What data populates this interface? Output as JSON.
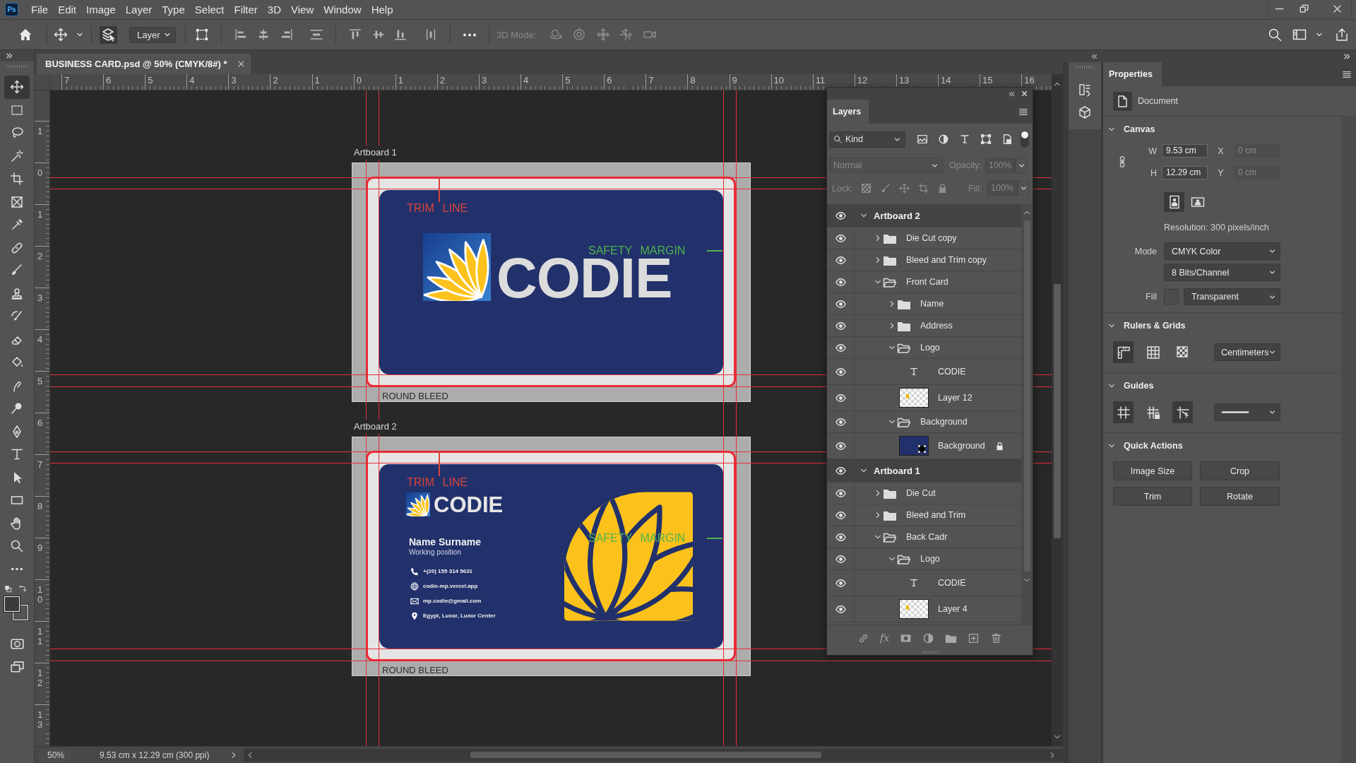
{
  "app": {
    "logo": "Ps"
  },
  "menu_bar": [
    "File",
    "Edit",
    "Image",
    "Layer",
    "Type",
    "Select",
    "Filter",
    "3D",
    "View",
    "Window",
    "Help"
  ],
  "options_bar": {
    "auto_select": {
      "on": true
    },
    "target": "Layer",
    "transform_controls": {
      "on": false
    },
    "three_d_label": "3D Mode:",
    "three_d_disabled": true
  },
  "document_tab": {
    "title": "BUSINESS CARD.psd @ 50% (CMYK/8#) *",
    "selected": true
  },
  "tools": [
    {
      "kind": "move",
      "selected": true
    },
    {
      "kind": "marquee",
      "selected": false
    },
    {
      "kind": "lasso",
      "selected": false
    },
    {
      "kind": "magic_wand",
      "selected": false
    },
    {
      "kind": "crop",
      "selected": false
    },
    {
      "kind": "frame",
      "selected": false
    },
    {
      "kind": "eyedropper",
      "selected": false
    },
    {
      "kind": "healing",
      "selected": false
    },
    {
      "kind": "brush",
      "selected": false
    },
    {
      "kind": "stamp",
      "selected": false
    },
    {
      "kind": "history_brush",
      "selected": false
    },
    {
      "kind": "eraser",
      "selected": false
    },
    {
      "kind": "bucket",
      "selected": false
    },
    {
      "kind": "smudge",
      "selected": false
    },
    {
      "kind": "dodge",
      "selected": false
    },
    {
      "kind": "pen",
      "selected": false
    },
    {
      "kind": "type",
      "selected": false
    },
    {
      "kind": "path_select",
      "selected": false
    },
    {
      "kind": "rectangle",
      "selected": false
    },
    {
      "kind": "hand",
      "selected": false
    },
    {
      "kind": "zoom",
      "selected": false
    },
    {
      "kind": "more",
      "selected": false
    }
  ],
  "rulers": {
    "horizontal": [
      "7",
      "6",
      "5",
      "4",
      "3",
      "2",
      "1",
      "0",
      "1",
      "2",
      "3",
      "4",
      "5",
      "6",
      "7",
      "8",
      "9",
      "10",
      "11",
      "12",
      "13",
      "14",
      "15",
      "16"
    ],
    "vertical": [
      "1",
      "0",
      "1",
      "2",
      "3",
      "4",
      "5",
      "6",
      "7",
      "8",
      "9",
      "10",
      "11",
      "12",
      "13"
    ]
  },
  "artboards": [
    {
      "label": "Artboard 1",
      "kind": "front",
      "trim_label": "TRIM LINE",
      "safety_label": "SAFETY MARGIN",
      "brand": "CODIE",
      "bleed_label": "ROUND BLEED"
    },
    {
      "label": "Artboard 2",
      "kind": "back",
      "trim_label": "TRIM LINE",
      "safety_label": "SAFETY MARGIN",
      "brand": "CODIE",
      "person_name": "Name Surname",
      "position": "Working position",
      "contacts": [
        {
          "kind": "phone",
          "text": "+(20) 155 314 5631"
        },
        {
          "kind": "web",
          "text": "codie-mp.vercel.app"
        },
        {
          "kind": "email",
          "text": "mp.codie@gmail.com"
        },
        {
          "kind": "address",
          "text": "Egypt, Luxor, Luxor Center"
        }
      ],
      "bleed_label": "ROUND BLEED"
    }
  ],
  "layers_panel": {
    "tab": "Layers",
    "filter": "Kind",
    "filter_on": true,
    "options_disabled": true,
    "blend_mode": "Normal",
    "opacity": {
      "label": "Opacity:",
      "value": "100%"
    },
    "lock_label": "Lock:",
    "fill": {
      "label": "Fill:",
      "value": "100%"
    },
    "effects_label": "fx",
    "layers": [
      {
        "name": "Artboard 2",
        "kind": "artboard",
        "visible": true,
        "locked": false,
        "expanded": true,
        "children": [
          {
            "name": "Die Cut copy",
            "kind": "group",
            "visible": true,
            "locked": false,
            "expanded": false
          },
          {
            "name": "Bleed and Trim copy",
            "kind": "group",
            "visible": true,
            "locked": false,
            "expanded": false
          },
          {
            "name": "Front Card",
            "kind": "group",
            "visible": true,
            "locked": false,
            "expanded": true,
            "children": [
              {
                "name": "Name",
                "kind": "group",
                "visible": true,
                "locked": false,
                "expanded": false
              },
              {
                "name": "Address",
                "kind": "group",
                "visible": true,
                "locked": false,
                "expanded": false
              },
              {
                "name": "Logo",
                "kind": "group",
                "visible": true,
                "locked": false,
                "expanded": true,
                "children": [
                  {
                    "name": "CODIE",
                    "kind": "text",
                    "visible": true,
                    "locked": false
                  },
                  {
                    "name": "Layer 12",
                    "kind": "pixel",
                    "visible": true,
                    "locked": false
                  }
                ]
              },
              {
                "name": "Background",
                "kind": "group",
                "visible": true,
                "locked": false,
                "expanded": true,
                "children": [
                  {
                    "name": "Background",
                    "kind": "fill",
                    "visible": true,
                    "locked": true
                  }
                ]
              }
            ]
          }
        ]
      },
      {
        "name": "Artboard 1",
        "kind": "artboard",
        "visible": true,
        "locked": false,
        "expanded": true,
        "children": [
          {
            "name": "Die Cut",
            "kind": "group",
            "visible": true,
            "locked": false,
            "expanded": false
          },
          {
            "name": "Bleed and Trim",
            "kind": "group",
            "visible": true,
            "locked": false,
            "expanded": false
          },
          {
            "name": "Back Cadr",
            "kind": "group",
            "visible": true,
            "locked": false,
            "expanded": true,
            "children": [
              {
                "name": "Logo",
                "kind": "group",
                "visible": true,
                "locked": false,
                "expanded": true,
                "children": [
                  {
                    "name": "CODIE",
                    "kind": "text",
                    "visible": true,
                    "locked": false
                  },
                  {
                    "name": "Layer 4",
                    "kind": "pixel",
                    "visible": true,
                    "locked": false
                  }
                ]
              }
            ]
          }
        ]
      }
    ]
  },
  "properties_panel": {
    "tab": "Properties",
    "target": "Document",
    "canvas": {
      "title": "Canvas",
      "expanded": true,
      "fields": [
        {
          "label": "W",
          "value": "9.53 cm",
          "disabled": false
        },
        {
          "label": "X",
          "value": "0 cm",
          "disabled": true
        },
        {
          "label": "H",
          "value": "12.29 cm",
          "disabled": false
        },
        {
          "label": "Y",
          "value": "0 cm",
          "disabled": true
        }
      ],
      "orientation": [
        {
          "kind": "portrait",
          "selected": true
        },
        {
          "kind": "landscape",
          "selected": false
        }
      ],
      "resolution": "Resolution: 300 pixels/inch",
      "mode_label": "Mode",
      "mode": "CMYK Color",
      "depth": "8 Bits/Channel",
      "fill_label": "Fill",
      "fill": "Transparent"
    },
    "rulers_grids": {
      "title": "Rulers & Grids",
      "expanded": true,
      "toggles": [
        {
          "kind": "rulers",
          "selected": true
        },
        {
          "kind": "grid",
          "selected": false
        },
        {
          "kind": "pixel_grid",
          "selected": false
        }
      ],
      "units": "Centimeters"
    },
    "guides": {
      "title": "Guides",
      "expanded": true,
      "toggles": [
        {
          "kind": "guides",
          "selected": true
        },
        {
          "kind": "lock_guides",
          "selected": false
        },
        {
          "kind": "smart_guides",
          "selected": true
        }
      ]
    },
    "quick_actions": {
      "title": "Quick Actions",
      "expanded": true,
      "buttons": [
        "Image Size",
        "Crop",
        "Trim",
        "Rotate"
      ]
    }
  },
  "status_bar": {
    "zoom": "50%",
    "document_info": "9.53 cm x 12.29 cm (300 ppi)"
  }
}
